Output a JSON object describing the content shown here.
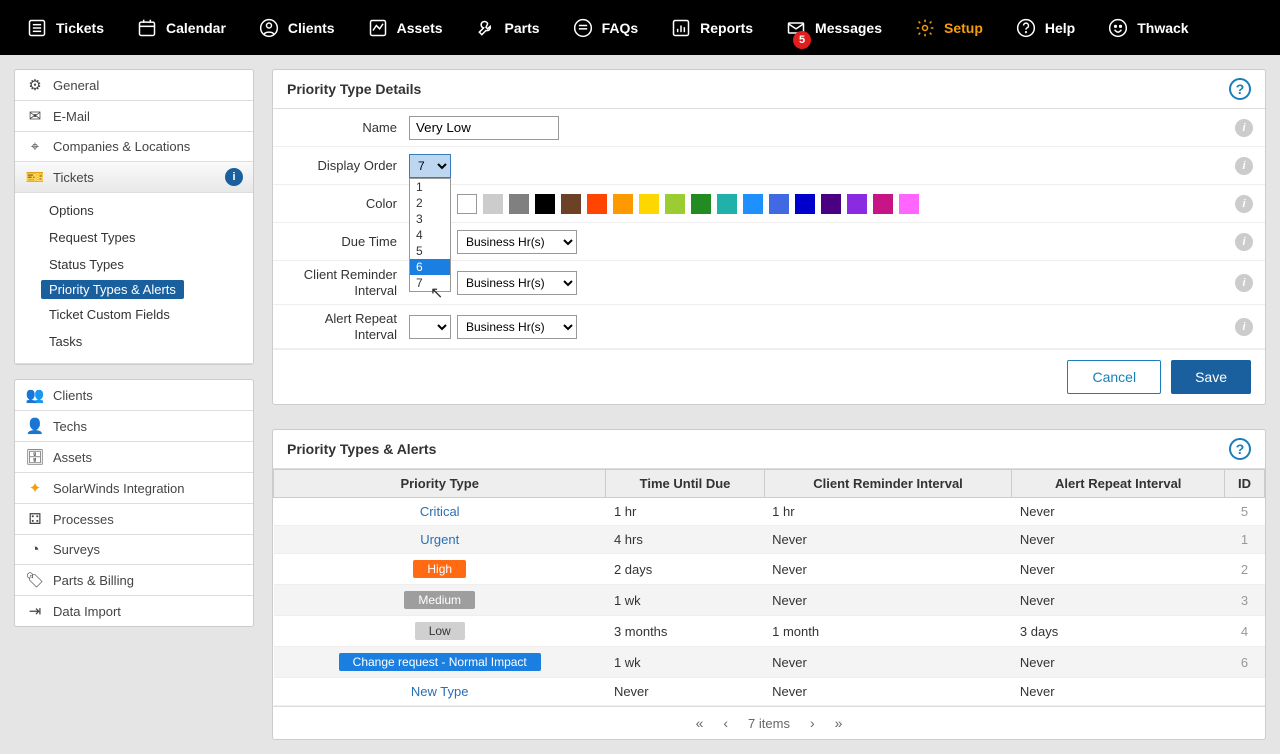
{
  "top_nav": {
    "items": [
      {
        "label": "Tickets"
      },
      {
        "label": "Calendar"
      },
      {
        "label": "Clients"
      },
      {
        "label": "Assets"
      },
      {
        "label": "Parts"
      },
      {
        "label": "FAQs"
      },
      {
        "label": "Reports"
      },
      {
        "label": "Messages",
        "badge": "5"
      },
      {
        "label": "Setup"
      },
      {
        "label": "Help"
      },
      {
        "label": "Thwack"
      }
    ]
  },
  "sidebar": {
    "top": [
      {
        "label": "General"
      },
      {
        "label": "E-Mail"
      },
      {
        "label": "Companies & Locations"
      },
      {
        "label": "Tickets"
      }
    ],
    "sub": [
      {
        "label": "Options"
      },
      {
        "label": "Request Types"
      },
      {
        "label": "Status Types"
      },
      {
        "label": "Priority Types & Alerts"
      },
      {
        "label": "Ticket Custom Fields"
      },
      {
        "label": "Tasks"
      }
    ],
    "bottom": [
      {
        "label": "Clients"
      },
      {
        "label": "Techs"
      },
      {
        "label": "Assets"
      },
      {
        "label": "SolarWinds Integration"
      },
      {
        "label": "Processes"
      },
      {
        "label": "Surveys"
      },
      {
        "label": "Parts & Billing"
      },
      {
        "label": "Data Import"
      }
    ]
  },
  "details_panel": {
    "title": "Priority Type Details",
    "labels": {
      "name": "Name",
      "display_order": "Display Order",
      "color": "Color",
      "due_time": "Due Time",
      "client_reminder": "Client Reminder Interval",
      "alert_repeat": "Alert Repeat Interval"
    },
    "name_value": "Very Low",
    "display_order_value": "7",
    "dropdown_options": [
      "1",
      "2",
      "3",
      "4",
      "5",
      "6",
      "7"
    ],
    "unit_option": "Business Hr(s)",
    "colors": [
      "#ffffff",
      "#cccccc",
      "#808080",
      "#000000",
      "#6b4226",
      "#ff4500",
      "#ff9900",
      "#ffd700",
      "#9acd32",
      "#228b22",
      "#20b2aa",
      "#1e90ff",
      "#4169e1",
      "#0000cd",
      "#4b0082",
      "#8a2be2",
      "#c71585",
      "#ff66ff"
    ],
    "cancel": "Cancel",
    "save": "Save"
  },
  "list_panel": {
    "title": "Priority Types & Alerts",
    "columns": [
      "Priority Type",
      "Time Until Due",
      "Client Reminder Interval",
      "Alert Repeat Interval",
      "ID"
    ],
    "rows": [
      {
        "name": "Critical",
        "style": "link",
        "due": "1 hr",
        "cri": "1 hr",
        "ari": "Never",
        "id": "5"
      },
      {
        "name": "Urgent",
        "style": "link",
        "due": "4 hrs",
        "cri": "Never",
        "ari": "Never",
        "id": "1"
      },
      {
        "name": "High",
        "style": "badge",
        "bg": "#ff6a13",
        "due": "2 days",
        "cri": "Never",
        "ari": "Never",
        "id": "2"
      },
      {
        "name": "Medium",
        "style": "badge",
        "bg": "#9e9e9e",
        "due": "1 wk",
        "cri": "Never",
        "ari": "Never",
        "id": "3"
      },
      {
        "name": "Low",
        "style": "badge",
        "bg": "#d0d0d0",
        "color": "#333",
        "due": "3 months",
        "cri": "1 month",
        "ari": "3 days",
        "id": "4"
      },
      {
        "name": "Change request - Normal Impact",
        "style": "badge",
        "bg": "#1a7fe0",
        "due": "1 wk",
        "cri": "Never",
        "ari": "Never",
        "id": "6"
      },
      {
        "name": "New Type",
        "style": "link",
        "due": "Never",
        "cri": "Never",
        "ari": "Never",
        "id": ""
      }
    ],
    "pager_text": "7 items"
  }
}
